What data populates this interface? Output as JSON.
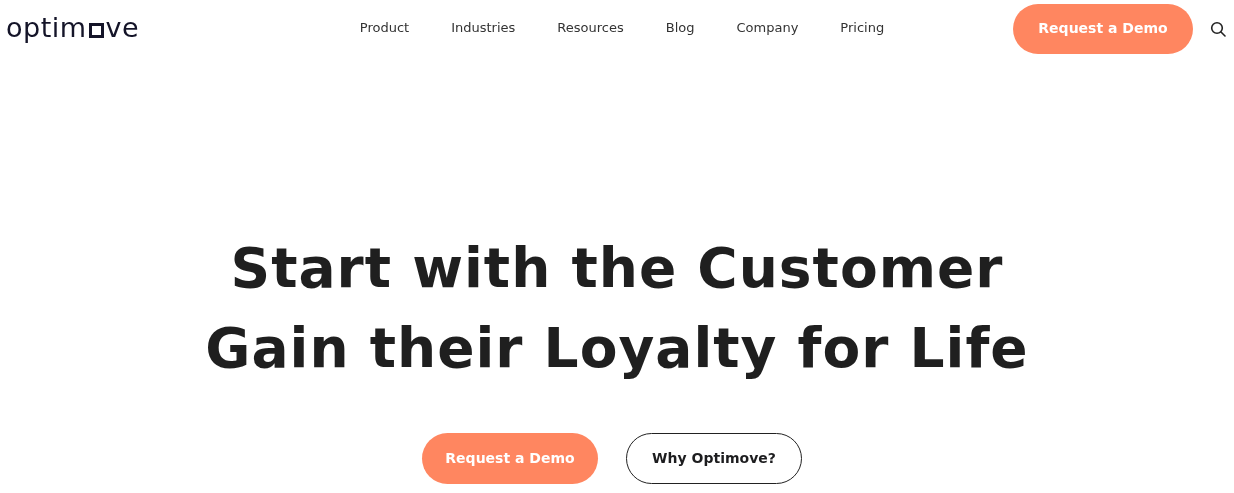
{
  "logo": {
    "parts": [
      "optim",
      "ve"
    ]
  },
  "nav": [
    {
      "label": "Product"
    },
    {
      "label": "Industries"
    },
    {
      "label": "Resources"
    },
    {
      "label": "Blog"
    },
    {
      "label": "Company"
    },
    {
      "label": "Pricing"
    }
  ],
  "header_button": "Request a Demo",
  "hero": {
    "lines": [
      "Start with the Customer",
      "Gain their Loyalty for Life"
    ],
    "buttons": [
      {
        "label": "Request a Demo",
        "kind": "primary"
      },
      {
        "label": "Why Optimove?",
        "kind": "outline"
      }
    ]
  }
}
